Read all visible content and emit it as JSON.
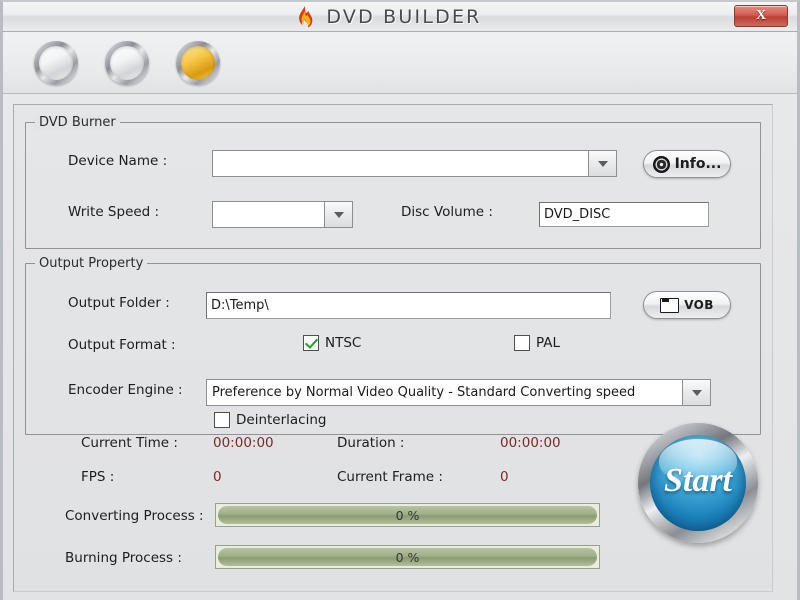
{
  "window": {
    "title": "DVD BUILDER",
    "close_label": "X",
    "flame_icon": "flame-icon"
  },
  "toolbar": {
    "buttons": [
      {
        "name": "disc-button-1",
        "state": "inactive",
        "icon": "disc-icon"
      },
      {
        "name": "disc-button-2",
        "state": "inactive",
        "icon": "disc-icon"
      },
      {
        "name": "disc-button-3",
        "state": "active",
        "icon": "disc-icon-gold"
      }
    ]
  },
  "burner": {
    "group_title": "DVD Burner",
    "device_name_label": "Device Name :",
    "device_name_value": "",
    "write_speed_label": "Write Speed :",
    "write_speed_value": "",
    "disc_volume_label": "Disc Volume :",
    "disc_volume_value": "DVD_DISC",
    "info_button_label": "Info...",
    "info_button_icon": "disc-icon"
  },
  "output": {
    "group_title": "Output Property",
    "output_folder_label": "Output Folder :",
    "output_folder_value": "D:\\Temp\\",
    "vob_button_label": "VOB",
    "vob_button_icon": "folder-icon",
    "output_format_label": "Output Format :",
    "ntsc_label": "NTSC",
    "ntsc_checked": true,
    "pal_label": "PAL",
    "pal_checked": false,
    "encoder_engine_label": "Encoder Engine :",
    "encoder_engine_value": "Preference by Normal Video Quality - Standard Converting speed",
    "deinterlacing_label": "Deinterlacing",
    "deinterlacing_checked": false
  },
  "status": {
    "current_time_label": "Current Time :",
    "current_time_value": "00:00:00",
    "duration_label": "Duration :",
    "duration_value": "00:00:00",
    "fps_label": "FPS :",
    "fps_value": "0",
    "current_frame_label": "Current Frame :",
    "current_frame_value": "0",
    "converting_label": "Converting Process :",
    "converting_percent": "0 %",
    "burning_label": "Burning Process :",
    "burning_percent": "0 %",
    "start_button_label": "Start"
  },
  "colors": {
    "accent_value_text": "#7a2b24",
    "checkbox_check": "#25a02a",
    "progress_fill": "#9fae88",
    "start_blue": "#1c82bb",
    "close_red": "#b93f34",
    "gold_disc": "#f6c94b"
  }
}
